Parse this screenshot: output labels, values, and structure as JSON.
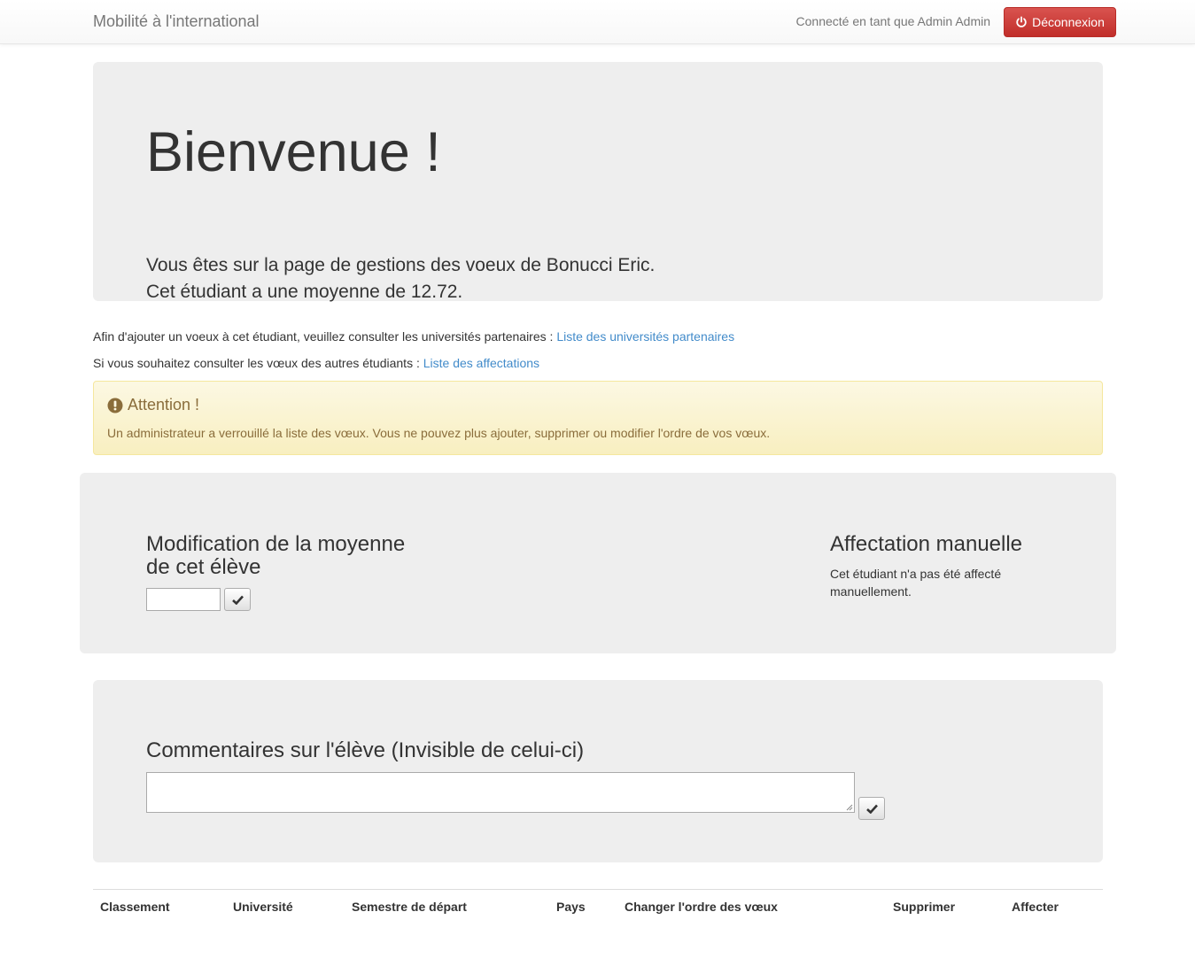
{
  "navbar": {
    "brand": "Mobilité à l'international",
    "connected_text": "Connecté en tant que Admin Admin",
    "logout_label": "Déconnexion"
  },
  "jumbotron": {
    "title": "Bienvenue !",
    "line1": "Vous êtes sur la page de gestions des voeux de Bonucci Eric.",
    "line2": "Cet étudiant a une moyenne de 12.72."
  },
  "info": {
    "line1_text": "Afin d'ajouter un voeux à cet étudiant, veuillez consulter les universités partenaires : ",
    "line1_link": "Liste des universités partenaires",
    "line2_text": "Si vous souhaitez consulter les vœux des autres étudiants : ",
    "line2_link": "Liste des affectations"
  },
  "alert": {
    "title": "Attention !",
    "text": "Un administrateur a verrouillé la liste des vœux. Vous ne pouvez plus ajouter, supprimer ou modifier l'ordre de vos vœux."
  },
  "moyenne": {
    "title_line1": "Modification de la moyenne",
    "title_line2": "de cet élève",
    "input_value": ""
  },
  "affectation": {
    "title": "Affectation manuelle",
    "text": "Cet étudiant n'a pas été affecté manuellement."
  },
  "comment": {
    "title": "Commentaires sur l'élève (Invisible de celui-ci)",
    "value": ""
  },
  "table": {
    "headers": [
      "Classement",
      "Université",
      "Semestre de départ",
      "Pays",
      "Changer l'ordre des vœux",
      "Supprimer",
      "Affecter"
    ]
  },
  "colors": {
    "danger": "#d9534f",
    "link": "#428bca",
    "warning_text": "#8a6d3b",
    "well": "#eeeeee"
  },
  "icons": [
    "power-icon",
    "exclamation-sign-icon",
    "checkmark-icon"
  ]
}
